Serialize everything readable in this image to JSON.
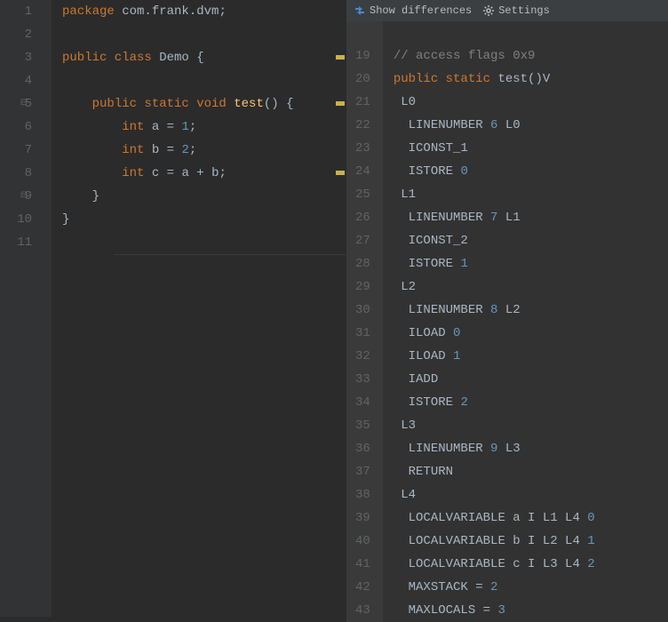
{
  "toolbar": {
    "show_diff": "Show differences",
    "settings": "Settings"
  },
  "left": {
    "gutter": [
      "1",
      "2",
      "3",
      "4",
      "5",
      "6",
      "7",
      "8",
      "9",
      "10",
      "11"
    ],
    "lines": [
      {
        "tokens": [
          {
            "t": "kw",
            "v": "package "
          },
          {
            "t": "pkg",
            "v": "com.frank.dvm"
          },
          {
            "t": "punc",
            "v": ";"
          }
        ]
      },
      {
        "tokens": []
      },
      {
        "tokens": [
          {
            "t": "kw",
            "v": "public class "
          },
          {
            "t": "type",
            "v": "Demo "
          },
          {
            "t": "punc",
            "v": "{"
          }
        ]
      },
      {
        "tokens": []
      },
      {
        "tokens": [
          {
            "t": "sp",
            "v": "    "
          },
          {
            "t": "kw",
            "v": "public static void "
          },
          {
            "t": "fn",
            "v": "test"
          },
          {
            "t": "punc",
            "v": "() {"
          }
        ]
      },
      {
        "tokens": [
          {
            "t": "sp",
            "v": "        "
          },
          {
            "t": "kw",
            "v": "int "
          },
          {
            "t": "ident",
            "v": "a "
          },
          {
            "t": "op",
            "v": "= "
          },
          {
            "t": "num",
            "v": "1"
          },
          {
            "t": "punc",
            "v": ";"
          }
        ]
      },
      {
        "tokens": [
          {
            "t": "sp",
            "v": "        "
          },
          {
            "t": "kw",
            "v": "int "
          },
          {
            "t": "ident",
            "v": "b "
          },
          {
            "t": "op",
            "v": "= "
          },
          {
            "t": "num",
            "v": "2"
          },
          {
            "t": "punc",
            "v": ";"
          }
        ]
      },
      {
        "tokens": [
          {
            "t": "sp",
            "v": "        "
          },
          {
            "t": "kw",
            "v": "int "
          },
          {
            "t": "ident",
            "v": "c "
          },
          {
            "t": "op",
            "v": "= "
          },
          {
            "t": "ident",
            "v": "a "
          },
          {
            "t": "op",
            "v": "+ "
          },
          {
            "t": "ident",
            "v": "b"
          },
          {
            "t": "punc",
            "v": ";"
          }
        ]
      },
      {
        "tokens": [
          {
            "t": "sp",
            "v": "    "
          },
          {
            "t": "punc",
            "v": "}"
          }
        ]
      },
      {
        "tokens": [
          {
            "t": "punc",
            "v": "}"
          }
        ]
      },
      {
        "tokens": []
      }
    ],
    "markers": [
      3,
      5,
      8
    ],
    "folds": [
      5,
      9
    ]
  },
  "right": {
    "gutter": [
      "",
      "19",
      "20",
      "21",
      "22",
      "23",
      "24",
      "25",
      "26",
      "27",
      "28",
      "29",
      "30",
      "31",
      "32",
      "33",
      "34",
      "35",
      "36",
      "37",
      "38",
      "39",
      "40",
      "41",
      "42",
      "43"
    ],
    "lines": [
      {
        "tokens": []
      },
      {
        "tokens": [
          {
            "t": "cmt",
            "v": "// access flags 0x9"
          }
        ]
      },
      {
        "tokens": [
          {
            "t": "kw",
            "v": "public static "
          },
          {
            "t": "ident",
            "v": "test()V"
          }
        ]
      },
      {
        "tokens": [
          {
            "t": "sp",
            "v": " "
          },
          {
            "t": "ident",
            "v": "L0"
          }
        ]
      },
      {
        "tokens": [
          {
            "t": "sp",
            "v": "  "
          },
          {
            "t": "ident",
            "v": "LINENUMBER "
          },
          {
            "t": "num",
            "v": "6 "
          },
          {
            "t": "ident",
            "v": "L0"
          }
        ]
      },
      {
        "tokens": [
          {
            "t": "sp",
            "v": "  "
          },
          {
            "t": "ident",
            "v": "ICONST_1"
          }
        ]
      },
      {
        "tokens": [
          {
            "t": "sp",
            "v": "  "
          },
          {
            "t": "ident",
            "v": "ISTORE "
          },
          {
            "t": "num",
            "v": "0"
          }
        ]
      },
      {
        "tokens": [
          {
            "t": "sp",
            "v": " "
          },
          {
            "t": "ident",
            "v": "L1"
          }
        ]
      },
      {
        "tokens": [
          {
            "t": "sp",
            "v": "  "
          },
          {
            "t": "ident",
            "v": "LINENUMBER "
          },
          {
            "t": "num",
            "v": "7 "
          },
          {
            "t": "ident",
            "v": "L1"
          }
        ]
      },
      {
        "tokens": [
          {
            "t": "sp",
            "v": "  "
          },
          {
            "t": "ident",
            "v": "ICONST_2"
          }
        ]
      },
      {
        "tokens": [
          {
            "t": "sp",
            "v": "  "
          },
          {
            "t": "ident",
            "v": "ISTORE "
          },
          {
            "t": "num",
            "v": "1"
          }
        ]
      },
      {
        "tokens": [
          {
            "t": "sp",
            "v": " "
          },
          {
            "t": "ident",
            "v": "L2"
          }
        ]
      },
      {
        "tokens": [
          {
            "t": "sp",
            "v": "  "
          },
          {
            "t": "ident",
            "v": "LINENUMBER "
          },
          {
            "t": "num",
            "v": "8 "
          },
          {
            "t": "ident",
            "v": "L2"
          }
        ]
      },
      {
        "tokens": [
          {
            "t": "sp",
            "v": "  "
          },
          {
            "t": "ident",
            "v": "ILOAD "
          },
          {
            "t": "num",
            "v": "0"
          }
        ]
      },
      {
        "tokens": [
          {
            "t": "sp",
            "v": "  "
          },
          {
            "t": "ident",
            "v": "ILOAD "
          },
          {
            "t": "num",
            "v": "1"
          }
        ]
      },
      {
        "tokens": [
          {
            "t": "sp",
            "v": "  "
          },
          {
            "t": "ident",
            "v": "IADD"
          }
        ]
      },
      {
        "tokens": [
          {
            "t": "sp",
            "v": "  "
          },
          {
            "t": "ident",
            "v": "ISTORE "
          },
          {
            "t": "num",
            "v": "2"
          }
        ]
      },
      {
        "tokens": [
          {
            "t": "sp",
            "v": " "
          },
          {
            "t": "ident",
            "v": "L3"
          }
        ]
      },
      {
        "tokens": [
          {
            "t": "sp",
            "v": "  "
          },
          {
            "t": "ident",
            "v": "LINENUMBER "
          },
          {
            "t": "num",
            "v": "9 "
          },
          {
            "t": "ident",
            "v": "L3"
          }
        ]
      },
      {
        "tokens": [
          {
            "t": "sp",
            "v": "  "
          },
          {
            "t": "ident",
            "v": "RETURN"
          }
        ]
      },
      {
        "tokens": [
          {
            "t": "sp",
            "v": " "
          },
          {
            "t": "ident",
            "v": "L4"
          }
        ]
      },
      {
        "tokens": [
          {
            "t": "sp",
            "v": "  "
          },
          {
            "t": "ident",
            "v": "LOCALVARIABLE a I L1 L4 "
          },
          {
            "t": "num",
            "v": "0"
          }
        ]
      },
      {
        "tokens": [
          {
            "t": "sp",
            "v": "  "
          },
          {
            "t": "ident",
            "v": "LOCALVARIABLE b I L2 L4 "
          },
          {
            "t": "num",
            "v": "1"
          }
        ]
      },
      {
        "tokens": [
          {
            "t": "sp",
            "v": "  "
          },
          {
            "t": "ident",
            "v": "LOCALVARIABLE c I L3 L4 "
          },
          {
            "t": "num",
            "v": "2"
          }
        ]
      },
      {
        "tokens": [
          {
            "t": "sp",
            "v": "  "
          },
          {
            "t": "ident",
            "v": "MAXSTACK = "
          },
          {
            "t": "num",
            "v": "2"
          }
        ]
      },
      {
        "tokens": [
          {
            "t": "sp",
            "v": "  "
          },
          {
            "t": "ident",
            "v": "MAXLOCALS = "
          },
          {
            "t": "num",
            "v": "3"
          }
        ]
      }
    ]
  }
}
